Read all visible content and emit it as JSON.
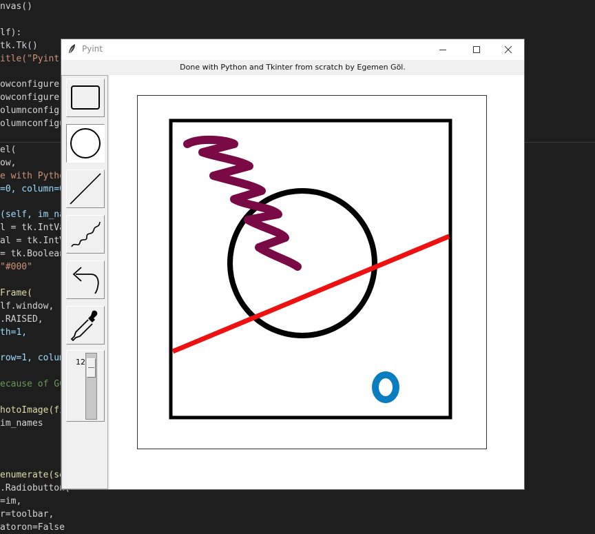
{
  "editor": {
    "lines": [
      {
        "text": "nvas()",
        "color": "#d4d4d4"
      },
      {
        "text": "",
        "color": "#d4d4d4"
      },
      {
        "text": "lf):",
        "color": "#d4d4d4"
      },
      {
        "text": "tk.Tk()",
        "color": "#d4d4d4"
      },
      {
        "text": "itle(\"Pyint\"",
        "color": "#ce9178"
      },
      {
        "text": "",
        "color": "#d4d4d4"
      },
      {
        "text": "owconfigure(",
        "color": "#d4d4d4"
      },
      {
        "text": "owconfigure(",
        "color": "#d4d4d4"
      },
      {
        "text": "olumnconfig",
        "color": "#d4d4d4"
      },
      {
        "text": "olumnconfigu",
        "color": "#d4d4d4"
      },
      {
        "text": "",
        "color": "#d4d4d4"
      },
      {
        "text": "el(",
        "color": "#d4d4d4"
      },
      {
        "text": "ow,",
        "color": "#d4d4d4"
      },
      {
        "text": "e with Pytho",
        "color": "#ce9178"
      },
      {
        "text": "=0, column=0",
        "color": "#9cdcfe"
      },
      {
        "text": "",
        "color": "#d4d4d4"
      },
      {
        "text": "(self, im_na",
        "color": "#9cdcfe"
      },
      {
        "text": "l = tk.IntVa",
        "color": "#d4d4d4"
      },
      {
        "text": "al = tk.IntV",
        "color": "#d4d4d4"
      },
      {
        "text": "= tk.Boolean",
        "color": "#d4d4d4"
      },
      {
        "text": "\"#000\"",
        "color": "#ce9178"
      },
      {
        "text": "",
        "color": "#d4d4d4"
      },
      {
        "text": "Frame(",
        "color": "#dcdcaa"
      },
      {
        "text": "lf.window,",
        "color": "#d4d4d4"
      },
      {
        "text": ".RAISED,",
        "color": "#d4d4d4"
      },
      {
        "text": "th=1,",
        "color": "#9cdcfe"
      },
      {
        "text": "",
        "color": "#d4d4d4"
      },
      {
        "text": "row=1, colum",
        "color": "#9cdcfe"
      },
      {
        "text": "",
        "color": "#d4d4d4"
      },
      {
        "text": "ecause of GC",
        "color": "#6a9955"
      },
      {
        "text": "",
        "color": "#d4d4d4"
      },
      {
        "text": "hotoImage(fi",
        "color": "#dcdcaa"
      },
      {
        "text": "im_names",
        "color": "#d4d4d4"
      },
      {
        "text": "",
        "color": "#d4d4d4"
      },
      {
        "text": "",
        "color": "#d4d4d4"
      },
      {
        "text": "",
        "color": "#d4d4d4"
      },
      {
        "text": "enumerate(se",
        "color": "#dcdcaa"
      },
      {
        "text": ".Radiobutton(",
        "color": "#d4d4d4"
      },
      {
        "text": "=im,",
        "color": "#d4d4d4"
      },
      {
        "text": "r=toolbar,",
        "color": "#d4d4d4"
      },
      {
        "text": "atoron=False",
        "color": "#d4d4d4"
      }
    ]
  },
  "window": {
    "title": "Pyint",
    "app_icon": "feather-icon",
    "controls": {
      "minimize": "minimize-icon",
      "maximize": "maximize-icon",
      "close": "close-icon"
    }
  },
  "status_text": "Done with Python and Tkinter from scratch by Egemen Göl.",
  "toolbar": {
    "tools": [
      {
        "name": "rectangle",
        "icon": "rectangle-icon",
        "selected": false
      },
      {
        "name": "oval",
        "icon": "circle-icon",
        "selected": true
      },
      {
        "name": "line",
        "icon": "line-icon",
        "selected": false
      },
      {
        "name": "freehand",
        "icon": "squiggle-icon",
        "selected": false
      },
      {
        "name": "undo",
        "icon": "undo-arrow-icon",
        "selected": false
      },
      {
        "name": "eyedropper",
        "icon": "eyedropper-icon",
        "selected": false
      }
    ],
    "brush_size": {
      "value": "12",
      "min": 1,
      "max": 100
    }
  },
  "colors": {
    "rectangle_stroke": "#000000",
    "circle_stroke": "#000000",
    "line_stroke": "#ee1111",
    "freehand_stroke": "#7a0a45",
    "small_oval_stroke": "#0a7dc0"
  }
}
